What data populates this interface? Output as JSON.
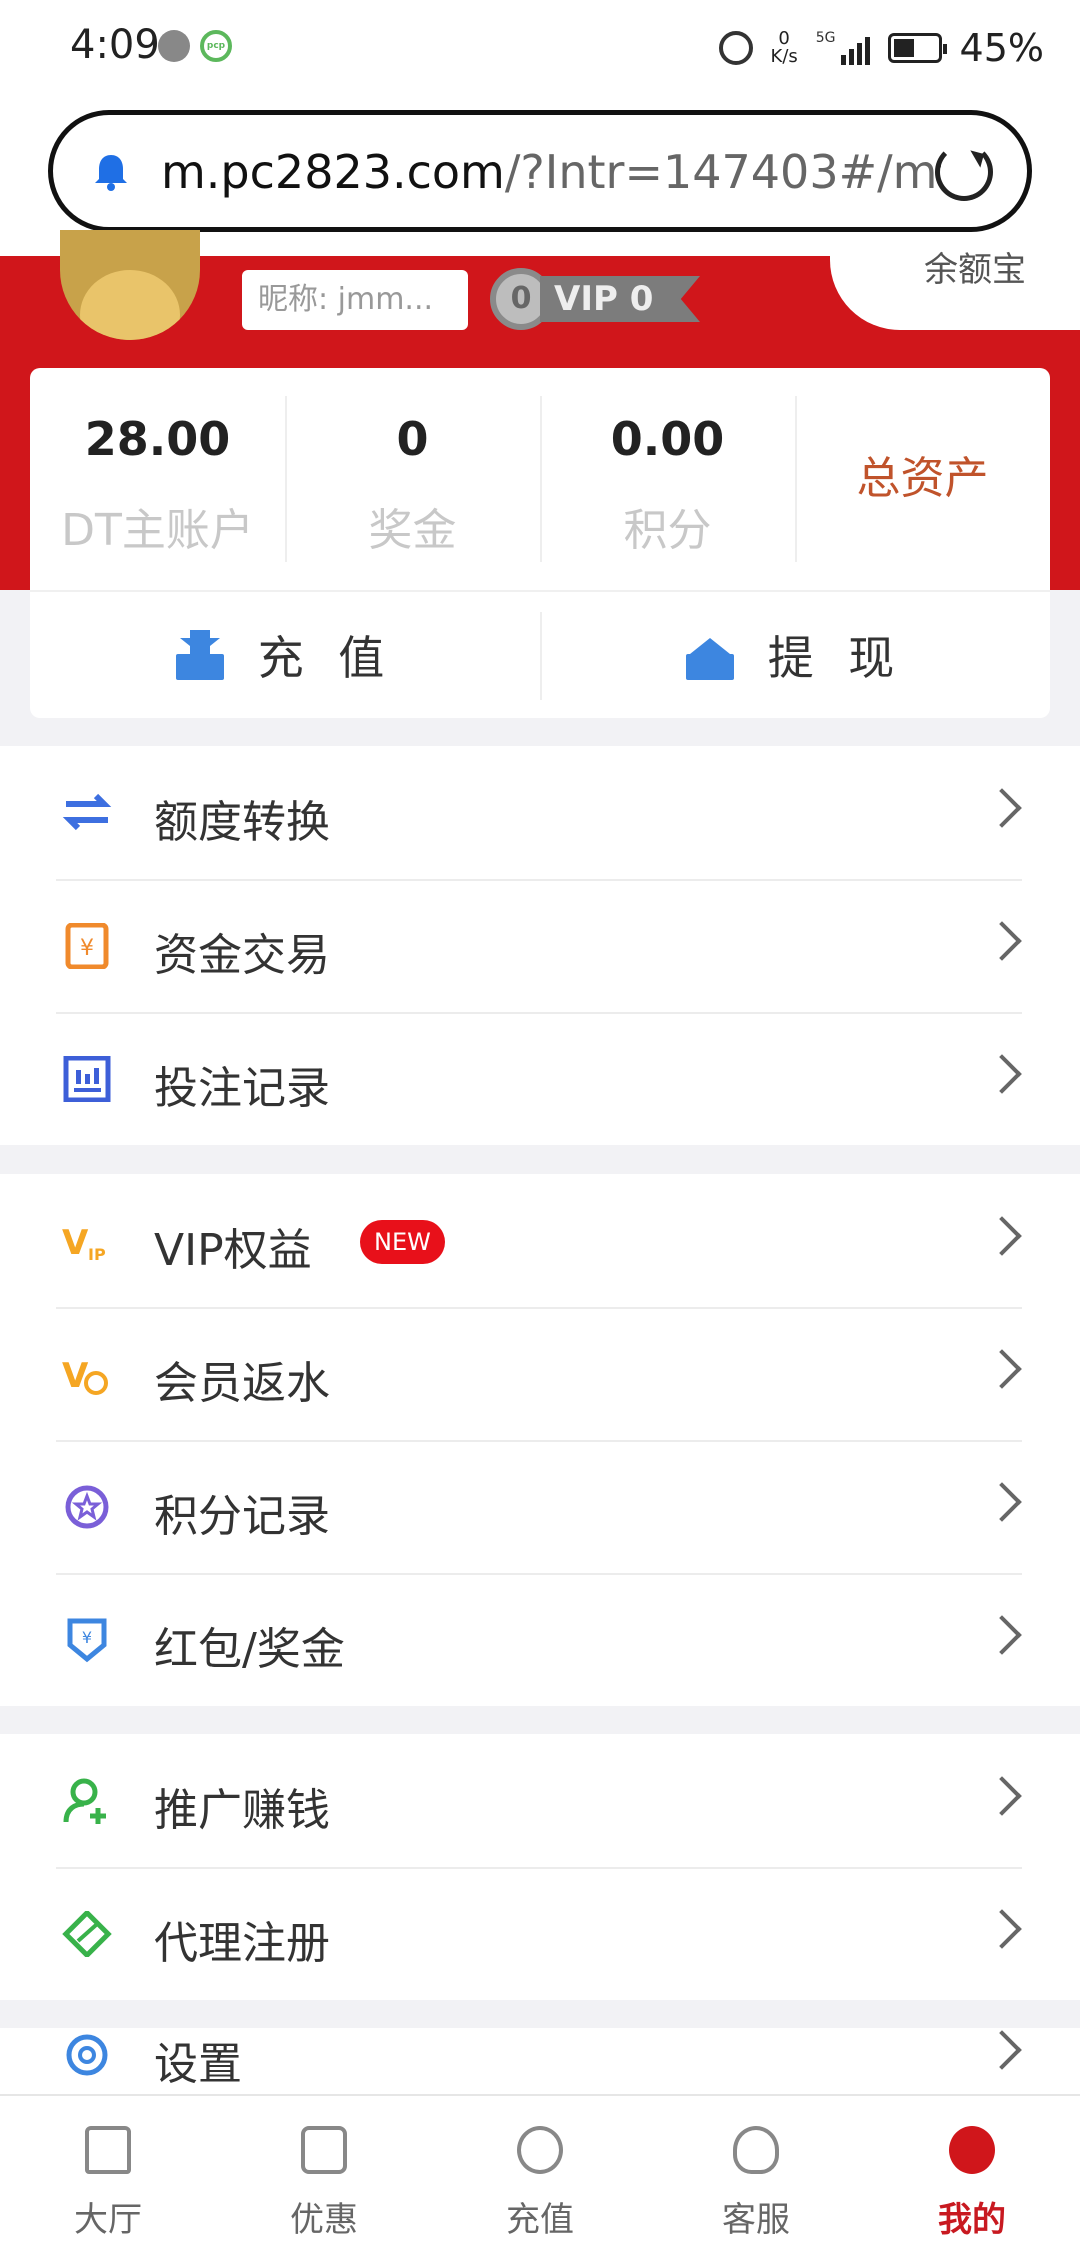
{
  "status_bar": {
    "time": "4:09",
    "net_speed": "0",
    "net_unit": "K/s",
    "network": "5G",
    "battery": "45%"
  },
  "browser": {
    "url_main": "m.pc2823.com",
    "url_rest": "/?Intr=147403#/my"
  },
  "profile": {
    "nickname": "昵称: jmm...",
    "vip_level": "0",
    "vip_label": "VIP 0",
    "yue_bao": "余额宝"
  },
  "stats": [
    {
      "value": "28.00",
      "label": "DT主账户"
    },
    {
      "value": "0",
      "label": "奖金"
    },
    {
      "value": "0.00",
      "label": "积分"
    },
    {
      "value": "",
      "label": "总资产"
    }
  ],
  "actions": {
    "deposit": "充 值",
    "withdraw": "提 现"
  },
  "menu_group_1": [
    {
      "label": "额度转换",
      "icon": "transfer-icon"
    },
    {
      "label": "资金交易",
      "icon": "fund-icon"
    },
    {
      "label": "投注记录",
      "icon": "bet-record-icon"
    }
  ],
  "menu_group_2": [
    {
      "label": "VIP权益",
      "icon": "vip-icon",
      "badge": "NEW"
    },
    {
      "label": "会员返水",
      "icon": "rebate-icon"
    },
    {
      "label": "积分记录",
      "icon": "points-icon"
    },
    {
      "label": "红包/奖金",
      "icon": "redpacket-icon"
    }
  ],
  "menu_group_3": [
    {
      "label": "推广赚钱",
      "icon": "promote-icon"
    },
    {
      "label": "代理注册",
      "icon": "agent-icon"
    }
  ],
  "menu_group_4": [
    {
      "label": "设置",
      "icon": "settings-icon"
    }
  ],
  "tabs": [
    {
      "label": "大厅",
      "icon": "home-icon"
    },
    {
      "label": "优惠",
      "icon": "promo-icon"
    },
    {
      "label": "充值",
      "icon": "deposit-icon"
    },
    {
      "label": "客服",
      "icon": "support-icon"
    },
    {
      "label": "我的",
      "icon": "profile-icon",
      "active": true
    }
  ],
  "colors": {
    "brand_red": "#d0161b",
    "total_assets": "#c0532b",
    "badge_red": "#e8101a"
  }
}
